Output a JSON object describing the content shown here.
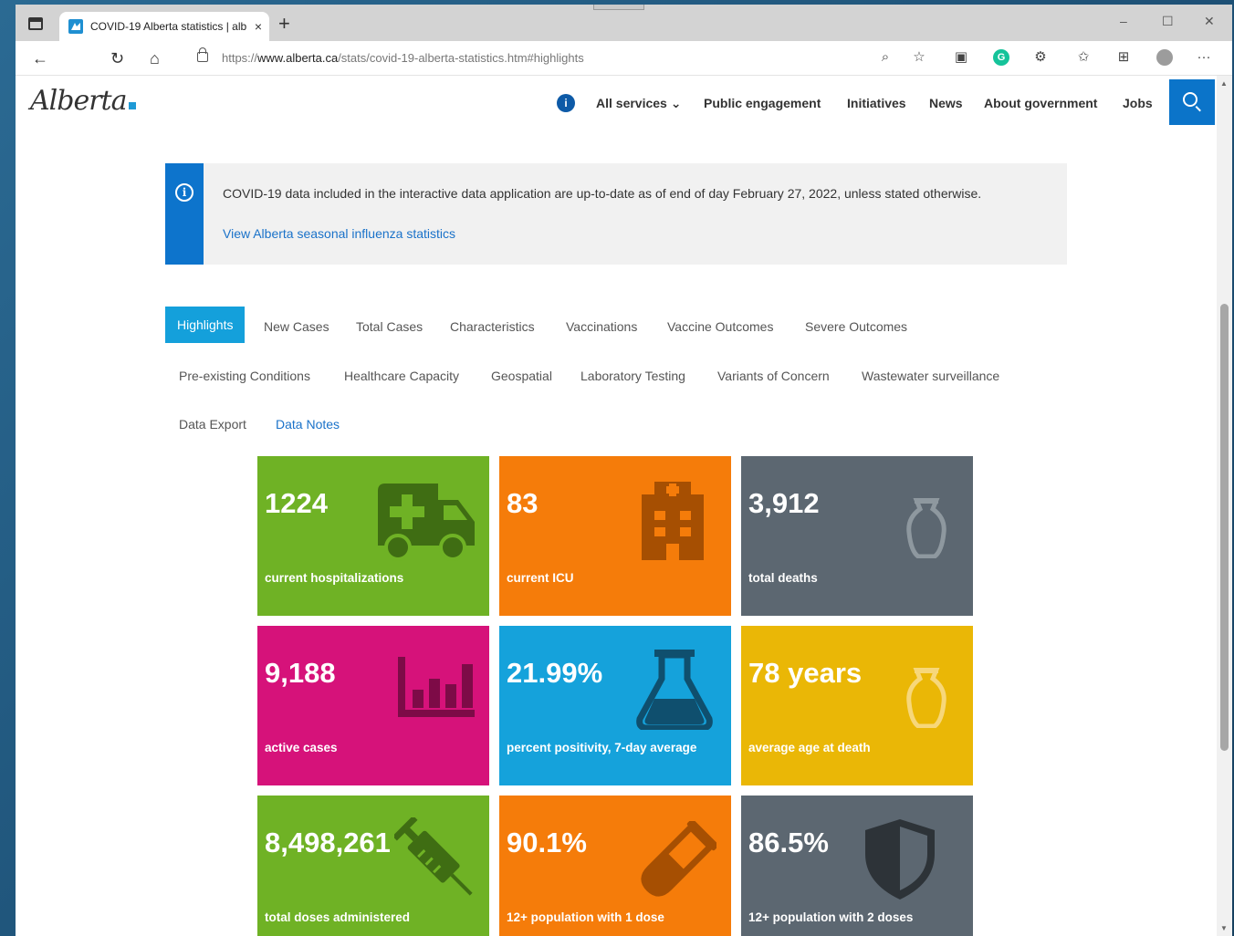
{
  "browser": {
    "tab_title": "COVID-19 Alberta statistics | alb",
    "tab_close": "×",
    "new_tab": "+",
    "url_prefix": "https://",
    "url_domain": "www.alberta.ca",
    "url_path": "/stats/covid-19-alberta-statistics.htm#highlights",
    "window_controls": {
      "minimize": "–",
      "maximize": "☐",
      "close": "✕"
    },
    "nav": {
      "back": "←",
      "refresh": "↻",
      "home": "⌂"
    },
    "toolbar_icons": [
      "zoom-icon",
      "favorite-add-icon",
      "extension-icon",
      "grammarly-icon",
      "extensions-icon",
      "favorites-icon",
      "collections-icon",
      "profile-icon",
      "more-icon"
    ],
    "toolbar_glyphs": {
      "zoom": "⌕",
      "favorite": "☆",
      "extension": "▣",
      "grammarly": "G",
      "extensions": "⚙",
      "favorites": "✩",
      "collections": "⊞",
      "more": "···"
    }
  },
  "site": {
    "logo_text": "Alberta",
    "info_badge": "i",
    "nav": {
      "all_services": "All services ⌄",
      "public_engagement": "Public engagement",
      "initiatives": "Initiatives",
      "news": "News",
      "about_government": "About government",
      "jobs": "Jobs"
    }
  },
  "notice": {
    "icon_glyph": "i",
    "text": "COVID-19 data included in the interactive data application are up-to-date as of end of day February 27, 2022, unless stated otherwise.",
    "link": "View Alberta seasonal influenza statistics"
  },
  "tabs": {
    "highlights": "Highlights",
    "new_cases": "New Cases",
    "total_cases": "Total Cases",
    "characteristics": "Characteristics",
    "vaccinations": "Vaccinations",
    "vaccine_outcomes": "Vaccine Outcomes",
    "severe_outcomes": "Severe Outcomes",
    "preexisting": "Pre-existing Conditions",
    "healthcare_capacity": "Healthcare Capacity",
    "geospatial": "Geospatial",
    "laboratory_testing": "Laboratory Testing",
    "variants": "Variants of Concern",
    "wastewater": "Wastewater surveillance",
    "data_export": "Data Export",
    "data_notes": "Data Notes"
  },
  "tiles": [
    {
      "value": "1224",
      "label": "current hospitalizations",
      "color": "#6fb225",
      "icon": "ambulance-icon"
    },
    {
      "value": "83",
      "label": "current ICU",
      "color": "#f57c0a",
      "icon": "hospital-icon"
    },
    {
      "value": "3,912",
      "label": "total deaths",
      "color": "#5c6771",
      "icon": "urn-icon"
    },
    {
      "value": "9,188",
      "label": "active cases",
      "color": "#d6127a",
      "icon": "bar-chart-icon"
    },
    {
      "value": "21.99%",
      "label": "percent positivity, 7-day average",
      "color": "#15a2db",
      "icon": "flask-icon"
    },
    {
      "value": "78 years",
      "label": "average age at death",
      "color": "#eab706",
      "icon": "urn-icon"
    },
    {
      "value": "8,498,261",
      "label": "total doses administered",
      "color": "#6fb225",
      "icon": "syringe-icon"
    },
    {
      "value": "90.1%",
      "label": "12+ population with 1 dose",
      "color": "#f57c0a",
      "icon": "test-tube-icon"
    },
    {
      "value": "86.5%",
      "label": "12+ population with 2 doses",
      "color": "#5c6771",
      "icon": "shield-icon"
    }
  ]
}
